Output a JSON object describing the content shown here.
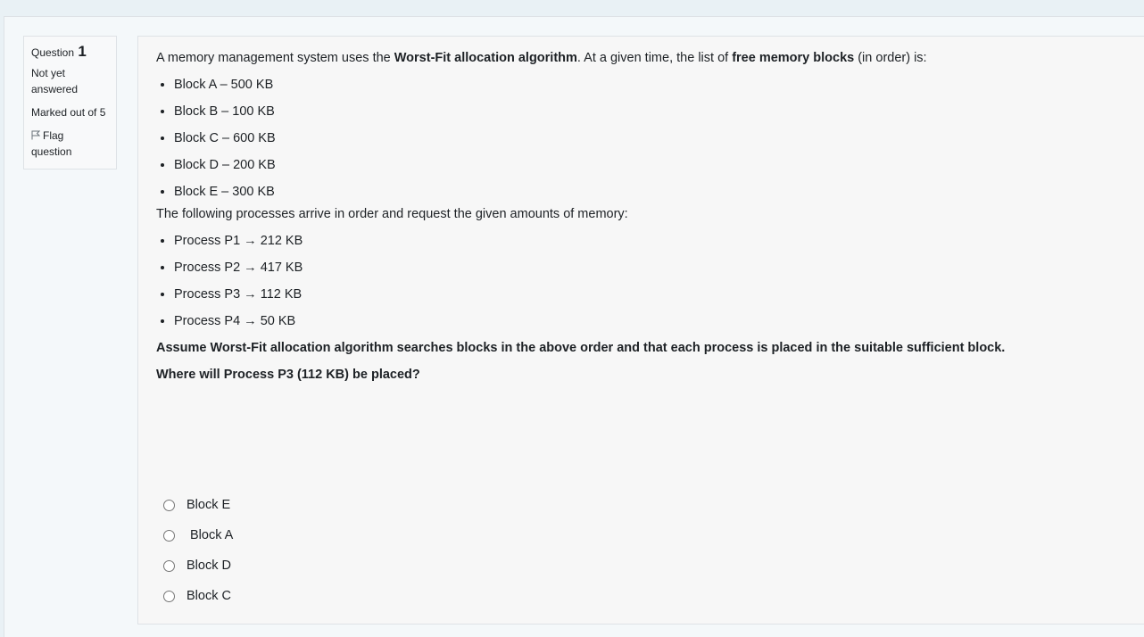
{
  "info": {
    "question_label": "Question",
    "question_number": "1",
    "state": "Not yet answered",
    "state_line1": "Not yet",
    "state_line2": "answered",
    "grade": "Marked out of 5",
    "flag_line1": "Flag",
    "flag_line2": "question"
  },
  "question": {
    "intro_1": "A memory management system uses the ",
    "intro_bold_1": "Worst-Fit allocation algorithm",
    "intro_2": ". At a given time, the list of ",
    "intro_bold_2": "free memory blocks",
    "intro_3": " (in order) is:",
    "blocks": [
      "Block A – 500 KB",
      "Block B – 100 KB",
      "Block C – 600 KB",
      "Block D – 200 KB",
      "Block E – 300 KB"
    ],
    "processes_intro": "The following processes arrive in order and request the given amounts of memory:",
    "processes": [
      "Process P1 → 212 KB",
      "Process P2 → 417 KB",
      "Process P3 → 112 KB",
      "Process P4 → 50 KB"
    ],
    "assumption": "Assume Worst-Fit allocation algorithm searches blocks in the above order and that each process is placed in the suitable sufficient block.",
    "prompt": "Where will Process P3 (112 KB) be placed?"
  },
  "answers": [
    "Block E",
    "Block A",
    "Block D",
    "Block C"
  ]
}
